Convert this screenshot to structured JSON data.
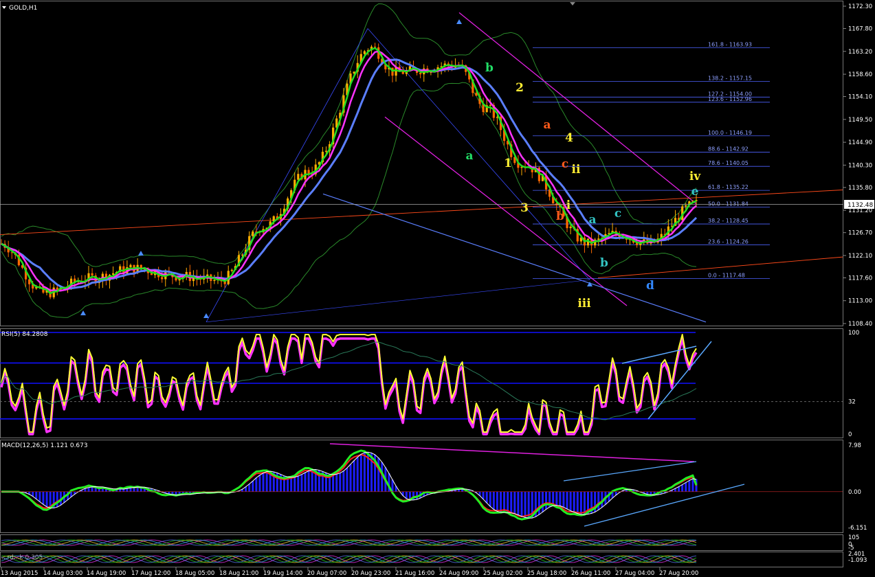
{
  "symbol_title": "GOLD,H1",
  "current_price_label": "1132.48",
  "colors": {
    "background": "#000000",
    "candle_up": "#ffb000",
    "candle_down": "#ff6a00",
    "ma_fast": "#22dd22",
    "ma_mid": "#ff33ff",
    "ma_slow": "#5b7fff",
    "channel": "#e020e0",
    "fib": "#4e63ff",
    "trendline": "#ff4a1a",
    "rsi_line": "#ffff33",
    "macd_hist": "#1d1dff",
    "divergence_line": "#5aa9ff"
  },
  "price_axis": {
    "ticks": [
      "1172.30",
      "1167.80",
      "1163.20",
      "1158.60",
      "1154.10",
      "1149.50",
      "1144.90",
      "1140.30",
      "1135.80",
      "1131.20",
      "1126.70",
      "1122.10",
      "1117.60",
      "1113.00",
      "1108.40"
    ]
  },
  "time_axis": {
    "ticks": [
      "13 Aug 2015",
      "14 Aug 03:00",
      "14 Aug 19:00",
      "17 Aug 12:00",
      "18 Aug 05:00",
      "18 Aug 21:00",
      "19 Aug 14:00",
      "20 Aug 07:00",
      "20 Aug 23:00",
      "21 Aug 16:00",
      "24 Aug 09:00",
      "25 Aug 02:00",
      "25 Aug 18:00",
      "26 Aug 11:00",
      "27 Aug 04:00",
      "27 Aug 20:00"
    ]
  },
  "fib_levels": [
    {
      "label": "161.8 - 1163.93"
    },
    {
      "label": "138.2 - 1157.15"
    },
    {
      "label": "127.2 - 1154.00"
    },
    {
      "label": "123.6 - 1152.96"
    },
    {
      "label": "100.0 - 1146.19"
    },
    {
      "label": "88.6 - 1142.92"
    },
    {
      "label": "78.6 - 1140.05"
    },
    {
      "label": "61.8 - 1135.22"
    },
    {
      "label": "50.0 - 1131.84"
    },
    {
      "label": "38.2 - 1128.45"
    },
    {
      "label": "23.6 - 1124.26"
    },
    {
      "label": "0.0 - 1117.48"
    }
  ],
  "wave_labels": [
    {
      "text": "a",
      "color": "#22dd66"
    },
    {
      "text": "b",
      "color": "#22dd66"
    },
    {
      "text": "2",
      "color": "#ffee33"
    },
    {
      "text": "1",
      "color": "#ffee33"
    },
    {
      "text": "a",
      "color": "#ff5a1a"
    },
    {
      "text": "4",
      "color": "#ffee33"
    },
    {
      "text": "c",
      "color": "#ff5a1a"
    },
    {
      "text": "ii",
      "color": "#ffee33"
    },
    {
      "text": "3",
      "color": "#ffee33"
    },
    {
      "text": "b",
      "color": "#ff5a1a"
    },
    {
      "text": "i",
      "color": "#ffee33"
    },
    {
      "text": "a",
      "color": "#33c4c4"
    },
    {
      "text": "b",
      "color": "#33c4c4"
    },
    {
      "text": "c",
      "color": "#33c4c4"
    },
    {
      "text": "d",
      "color": "#3388ff"
    },
    {
      "text": "e",
      "color": "#33c4c4"
    },
    {
      "text": "iv",
      "color": "#ffee33"
    },
    {
      "text": "iii",
      "color": "#ffee33"
    }
  ],
  "rsi": {
    "title": "RSI(5) 84.2808",
    "ticks": [
      "100",
      "32",
      "0"
    ]
  },
  "macd": {
    "title": "MACD(12,26,5) 1.121 0.673",
    "ticks": [
      "7.98",
      "0.00",
      "-6.151"
    ]
  },
  "sub_panel_ticks": [
    "105",
    "0",
    "-5",
    "2.401",
    "-1.093"
  ],
  "sub_panel_title": "...rd...k 0.305",
  "chart_data": {
    "type": "candlestick",
    "title": "GOLD,H1",
    "ylim": [
      1108.4,
      1172.3
    ],
    "x": [
      "13 Aug 2015",
      "14 Aug 03:00",
      "14 Aug 19:00",
      "17 Aug 12:00",
      "18 Aug 05:00",
      "18 Aug 21:00",
      "19 Aug 14:00",
      "20 Aug 07:00",
      "20 Aug 23:00",
      "21 Aug 16:00",
      "24 Aug 09:00",
      "25 Aug 02:00",
      "25 Aug 18:00",
      "26 Aug 11:00",
      "27 Aug 04:00",
      "27 Aug 20:00",
      "28 Aug 06:00"
    ],
    "close": [
      1124.5,
      1114.5,
      1117.5,
      1119.5,
      1118.0,
      1117.0,
      1128.0,
      1139.0,
      1164.0,
      1159.0,
      1160.5,
      1152.0,
      1140.5,
      1124.5,
      1126.5,
      1124.5,
      1132.5
    ],
    "fib_values": [
      1163.93,
      1157.15,
      1154.0,
      1152.96,
      1146.19,
      1142.92,
      1140.05,
      1135.22,
      1131.84,
      1128.45,
      1124.26,
      1117.48
    ],
    "last_price": 1132.48,
    "rsi_value": 84.2808,
    "macd_values": [
      1.121,
      0.673
    ]
  }
}
